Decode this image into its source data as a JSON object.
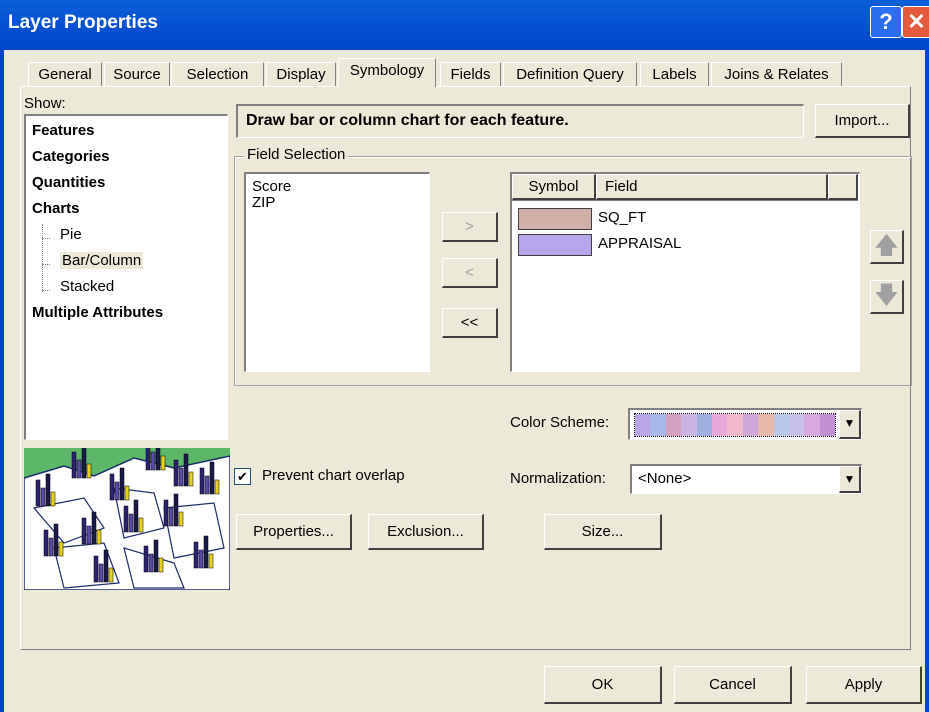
{
  "window": {
    "title": "Layer Properties",
    "help_glyph": "?",
    "close_glyph": "✕"
  },
  "tabs": [
    {
      "label": "General"
    },
    {
      "label": "Source"
    },
    {
      "label": "Selection"
    },
    {
      "label": "Display"
    },
    {
      "label": "Symbology",
      "active": true
    },
    {
      "label": "Fields"
    },
    {
      "label": "Definition Query"
    },
    {
      "label": "Labels"
    },
    {
      "label": "Joins & Relates"
    }
  ],
  "show": {
    "label": "Show:",
    "items": [
      {
        "label": "Features",
        "bold": true
      },
      {
        "label": "Categories",
        "bold": true
      },
      {
        "label": "Quantities",
        "bold": true
      },
      {
        "label": "Charts",
        "bold": true
      },
      {
        "label": "Pie",
        "bold": false
      },
      {
        "label": "Bar/Column",
        "bold": false,
        "selected": true
      },
      {
        "label": "Stacked",
        "bold": false
      },
      {
        "label": "Multiple Attributes",
        "bold": true
      }
    ]
  },
  "description": "Draw bar or column chart for each feature.",
  "import_label": "Import...",
  "field_selection": {
    "label": "Field Selection",
    "available": [
      "Score",
      "ZIP"
    ],
    "buttons": {
      "add": ">",
      "remove": "<",
      "remove_all": "<<"
    },
    "columns": {
      "symbol": "Symbol",
      "field": "Field"
    },
    "selected_fields": [
      {
        "field": "SQ_FT",
        "color": "#cfafa8"
      },
      {
        "field": "APPRAISAL",
        "color": "#b6a7ec"
      }
    ]
  },
  "color_scheme": {
    "label": "Color Scheme:",
    "swatches": [
      "#b9a6e6",
      "#a8b8e8",
      "#d4a0c0",
      "#c9b4e4",
      "#9fb0e0",
      "#e6a8d8",
      "#f0b8c8",
      "#d0a8d8",
      "#e8b8a8",
      "#b8c8e8",
      "#c8c0e8",
      "#d8a8e0",
      "#c090d0"
    ]
  },
  "prevent_overlap": {
    "label": "Prevent chart overlap",
    "checked": true,
    "check_glyph": "✔"
  },
  "normalization": {
    "label": "Normalization:",
    "value": "<None>"
  },
  "buttons": {
    "properties": "Properties...",
    "exclusion": "Exclusion...",
    "size": "Size...",
    "ok": "OK",
    "cancel": "Cancel",
    "apply": "Apply"
  }
}
